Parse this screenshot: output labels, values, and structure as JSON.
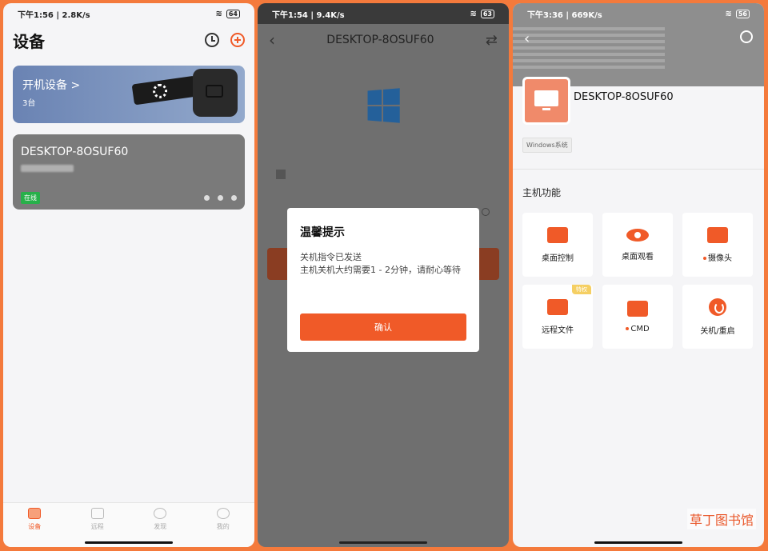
{
  "screen1": {
    "status": {
      "time": "下午1:56 | 2.8K/s",
      "battery": "64"
    },
    "title": "设备",
    "boot_card": {
      "label": "开机设备 >",
      "count": "3台"
    },
    "pc_card": {
      "name": "DESKTOP-8OSUF60",
      "status": "在线"
    },
    "tabs": [
      "设备",
      "远程",
      "发现",
      "我的"
    ]
  },
  "screen2": {
    "status": {
      "time": "下午1:54 | 9.4K/s",
      "battery": "63"
    },
    "title": "DESKTOP-8OSUF60",
    "dialog": {
      "title": "温馨提示",
      "line1": "关机指令已发送",
      "line2": "主机关机大约需要1 - 2分钟，请耐心等待",
      "confirm": "确认"
    }
  },
  "screen3": {
    "status": {
      "time": "下午3:36 | 669K/s",
      "battery": "56"
    },
    "name": "DESKTOP-8OSUF60",
    "system": "Windows系统",
    "section": "主机功能",
    "features": [
      {
        "label": "桌面控制",
        "dot": false,
        "badge": ""
      },
      {
        "label": "桌面观看",
        "dot": false,
        "badge": ""
      },
      {
        "label": "摄像头",
        "dot": true,
        "badge": ""
      },
      {
        "label": "远程文件",
        "dot": false,
        "badge": "特权"
      },
      {
        "label": "CMD",
        "dot": true,
        "badge": ""
      },
      {
        "label": "关机/重启",
        "dot": false,
        "badge": ""
      }
    ]
  },
  "watermark": "草丁图书馆",
  "colors": {
    "accent": "#f05a28",
    "frame": "#f47a3c",
    "online": "#27b04a"
  }
}
